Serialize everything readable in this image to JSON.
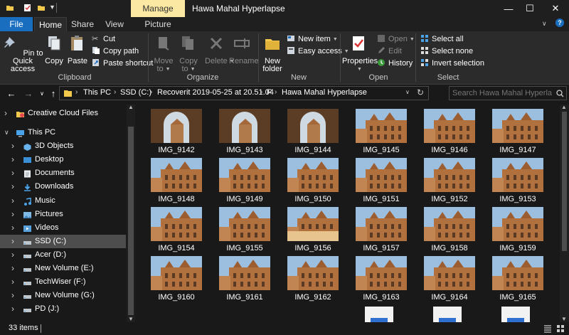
{
  "window": {
    "title": "Hawa Mahal Hyperlapse",
    "context_tab": "Manage",
    "controls": [
      "minimize",
      "maximize",
      "close"
    ]
  },
  "ribbon_tabs": [
    "File",
    "Home",
    "Share",
    "View",
    "Picture Tools"
  ],
  "ribbon": {
    "clipboard": {
      "label": "Clipboard",
      "pin": "Pin to Quick access",
      "copy": "Copy",
      "paste": "Paste",
      "cut": "Cut",
      "copy_path": "Copy path",
      "paste_shortcut": "Paste shortcut"
    },
    "organize": {
      "label": "Organize",
      "move_to": "Move to",
      "copy_to": "Copy to",
      "delete": "Delete",
      "rename": "Rename"
    },
    "new": {
      "label": "New",
      "new_folder": "New folder",
      "new_item": "New item",
      "easy_access": "Easy access"
    },
    "open": {
      "label": "Open",
      "properties": "Properties",
      "open": "Open",
      "edit": "Edit",
      "history": "History"
    },
    "select": {
      "label": "Select",
      "select_all": "Select all",
      "select_none": "Select none",
      "invert": "Invert selection"
    }
  },
  "address": {
    "breadcrumbs": [
      "This PC",
      "SSD (C:)",
      "Recoverit 2019-05-25 at 20.51.04",
      "F",
      "Hawa Mahal Hyperlapse"
    ],
    "search_placeholder": "Search Hawa Mahal Hyperlapse"
  },
  "sidebar": {
    "items": [
      {
        "label": "Creative Cloud Files",
        "icon": "creative-cloud-icon",
        "level": 0
      },
      {
        "label": "This PC",
        "icon": "pc-icon",
        "level": 0,
        "expanded": true
      },
      {
        "label": "3D Objects",
        "icon": "3d-objects-icon",
        "level": 1
      },
      {
        "label": "Desktop",
        "icon": "desktop-icon",
        "level": 1
      },
      {
        "label": "Documents",
        "icon": "documents-icon",
        "level": 1
      },
      {
        "label": "Downloads",
        "icon": "downloads-icon",
        "level": 1
      },
      {
        "label": "Music",
        "icon": "music-icon",
        "level": 1
      },
      {
        "label": "Pictures",
        "icon": "pictures-icon",
        "level": 1
      },
      {
        "label": "Videos",
        "icon": "videos-icon",
        "level": 1
      },
      {
        "label": "SSD (C:)",
        "icon": "drive-icon",
        "level": 1,
        "selected": true
      },
      {
        "label": "Acer (D:)",
        "icon": "drive-icon",
        "level": 1
      },
      {
        "label": "New Volume (E:)",
        "icon": "drive-icon",
        "level": 1
      },
      {
        "label": "TechWiser (F:)",
        "icon": "drive-icon",
        "level": 1
      },
      {
        "label": "New Volume (G:)",
        "icon": "drive-icon",
        "level": 1
      },
      {
        "label": "PD (J:)",
        "icon": "drive-icon",
        "level": 1
      }
    ]
  },
  "files": [
    "IMG_9142",
    "IMG_9143",
    "IMG_9144",
    "IMG_9145",
    "IMG_9146",
    "IMG_9147",
    "IMG_9148",
    "IMG_9149",
    "IMG_9150",
    "IMG_9151",
    "IMG_9152",
    "IMG_9153",
    "IMG_9154",
    "IMG_9155",
    "IMG_9156",
    "IMG_9157",
    "IMG_9158",
    "IMG_9159",
    "IMG_9160",
    "IMG_9161",
    "IMG_9162",
    "IMG_9163",
    "IMG_9164",
    "IMG_9165"
  ],
  "status": {
    "item_count": "33 items"
  },
  "colors": {
    "accent": "#1a6ec0",
    "manage_tab": "#fbe9a3",
    "selection": "#4d4d4d",
    "background": "#191919"
  }
}
